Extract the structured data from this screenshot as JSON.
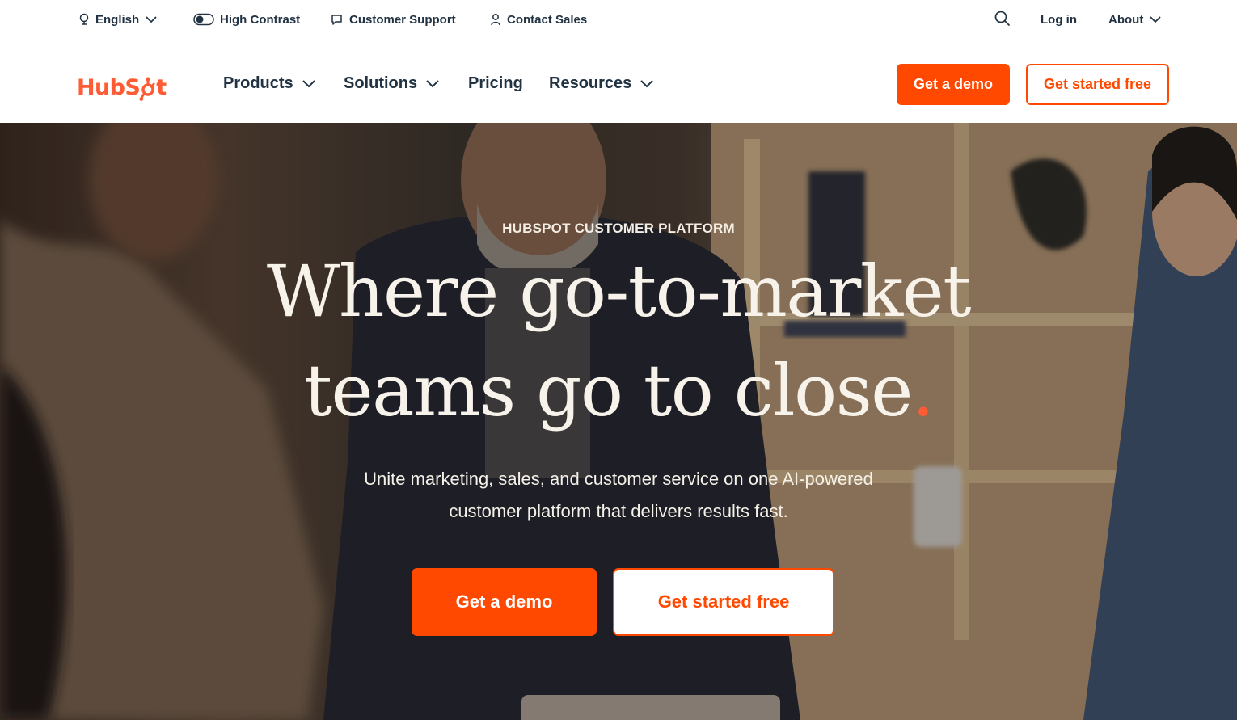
{
  "utility": {
    "language_label": "English",
    "contrast_label": "High Contrast",
    "support_label": "Customer Support",
    "sales_label": "Contact Sales",
    "login_label": "Log in",
    "about_label": "About"
  },
  "nav": {
    "logo_text_1": "HubS",
    "logo_text_2": "t",
    "products_label": "Products",
    "solutions_label": "Solutions",
    "pricing_label": "Pricing",
    "resources_label": "Resources",
    "demo_label": "Get a demo",
    "free_label": "Get started free"
  },
  "hero": {
    "eyebrow": "HUBSPOT CUSTOMER PLATFORM",
    "headline_line1": "Where go-to-market",
    "headline_line2": "teams go to close",
    "headline_dot": ".",
    "subtext_line1": "Unite marketing, sales, and customer service on one AI-powered",
    "subtext_line2": "customer platform that delivers results fast.",
    "demo_label": "Get a demo",
    "free_label": "Get started free"
  },
  "colors": {
    "accent": "#ff4800",
    "logo": "#ff5c35",
    "text_dark": "#213343"
  },
  "icons": [
    "globe-icon",
    "contrast-toggle-icon",
    "chat-icon",
    "person-icon",
    "search-icon",
    "chevron-down-icon"
  ]
}
